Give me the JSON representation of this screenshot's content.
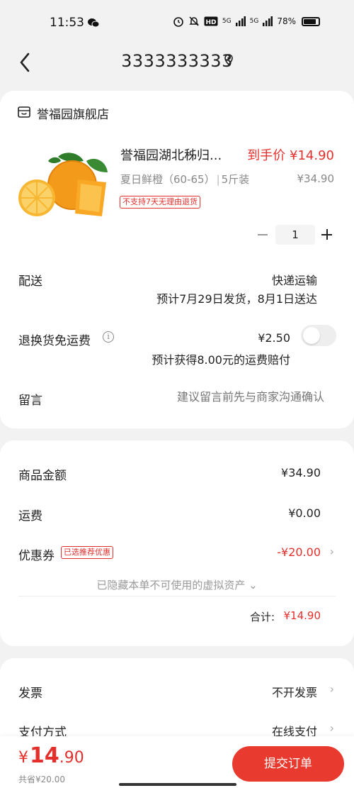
{
  "status_bar": {
    "time": "11:53",
    "battery": "78%",
    "signal_1": "5G",
    "signal_2": "5G"
  },
  "header": {
    "title": "3333333333"
  },
  "store": {
    "name": "誉福园旗舰店"
  },
  "product": {
    "title": "誉福园湖北秭归...",
    "price_label": "到手价 ¥14.90",
    "spec": "夏日鲜橙（60-65）",
    "pack": "5斤装",
    "original_price": "¥34.90",
    "tag": "不支持7天无理由退货",
    "quantity": "1"
  },
  "shipping": {
    "label": "配送",
    "method": "快递运输",
    "estimate": "预计7月29日发货，8月1日送达"
  },
  "return_insurance": {
    "label": "退换货免运费",
    "info": "i",
    "price": "¥2.50",
    "note": "预计获得8.00元的运费赔付",
    "enabled": false
  },
  "message": {
    "label": "留言",
    "placeholder": "建议留言前先与商家沟通确认"
  },
  "summary": {
    "goods_label": "商品金额",
    "goods_value": "¥34.90",
    "freight_label": "运费",
    "freight_value": "¥0.00",
    "coupon_label": "优惠券",
    "coupon_tag": "已选推荐优惠",
    "coupon_value": "-¥20.00",
    "hidden_assets": "已隐藏本单不可使用的虚拟资产 ⌄",
    "total_label": "合计:",
    "total_value": "¥14.90"
  },
  "invoice": {
    "label": "发票",
    "value": "不开发票"
  },
  "payment": {
    "label": "支付方式",
    "value": "在线支付"
  },
  "bottom": {
    "currency": "¥",
    "amount_int": "14",
    "amount_dec": ".90",
    "saved": "共省¥20.00",
    "submit": "提交订单"
  },
  "icons": {
    "chevron": "›",
    "back": "chevron-left-icon",
    "location": "location-pin-icon",
    "store": "store-icon",
    "wechat": "wechat-icon"
  },
  "colors": {
    "accent": "#e4302c",
    "button": "#e83a2e",
    "background": "#f2f2f2"
  }
}
